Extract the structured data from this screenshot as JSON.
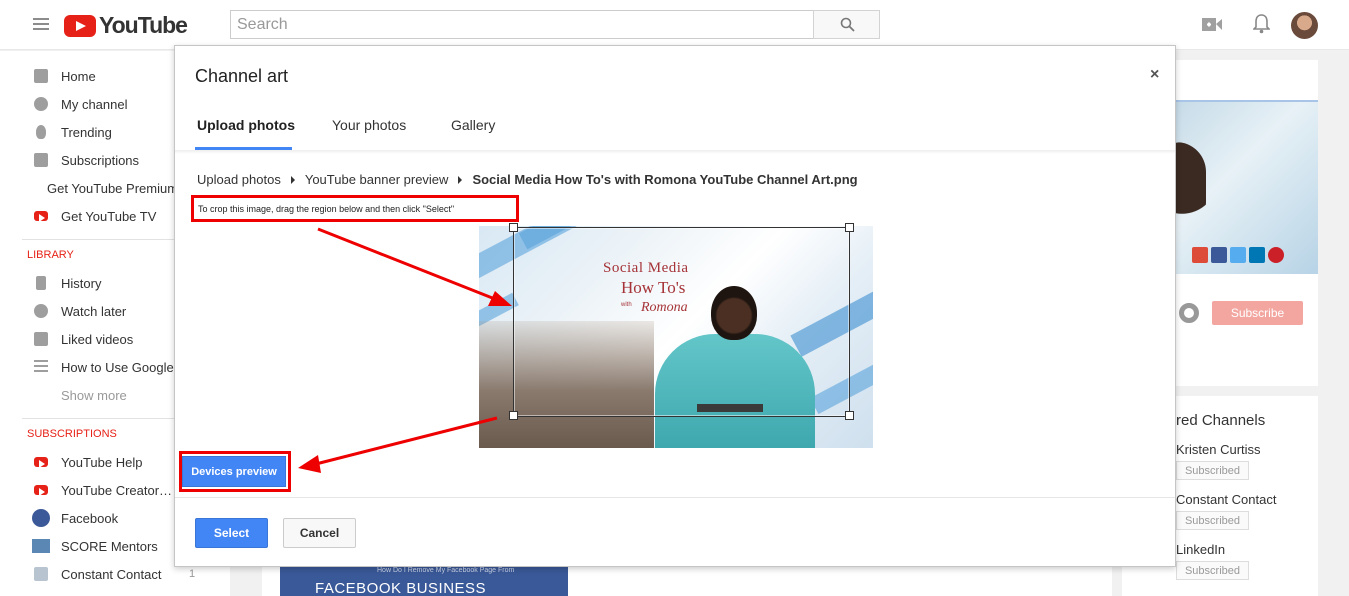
{
  "app": {
    "logo_text": "YouTube",
    "search_placeholder": "Search"
  },
  "sidebar": {
    "main_items": [
      {
        "label": "Home"
      },
      {
        "label": "My channel"
      },
      {
        "label": "Trending"
      },
      {
        "label": "Subscriptions"
      },
      {
        "label": "Get YouTube Premium"
      },
      {
        "label": "Get YouTube TV"
      }
    ],
    "library_heading": "LIBRARY",
    "library_items": [
      {
        "label": "History"
      },
      {
        "label": "Watch later"
      },
      {
        "label": "Liked videos"
      },
      {
        "label": "How to Use Google"
      }
    ],
    "show_more": "Show more",
    "subscriptions_heading": "SUBSCRIPTIONS",
    "subscription_items": [
      {
        "label": "YouTube Help"
      },
      {
        "label": "YouTube Creator…"
      },
      {
        "label": "Facebook"
      },
      {
        "label": "SCORE Mentors"
      },
      {
        "label": "Constant Contact",
        "count": "1"
      }
    ]
  },
  "right_panel": {
    "subscribe_label": "Subscribe",
    "featured_title": "red Channels",
    "featured": [
      {
        "name": "Kristen Curtiss",
        "status": "Subscribed"
      },
      {
        "name": "Constant Contact",
        "status": "Subscribed"
      },
      {
        "name": "LinkedIn",
        "status": "Subscribed"
      }
    ]
  },
  "background_card": {
    "small_text": "How Do I Remove My Facebook Page From",
    "big_text": "FACEBOOK BUSINESS MANAGER"
  },
  "modal": {
    "title": "Channel art",
    "close": "×",
    "tabs": [
      {
        "label": "Upload photos",
        "active": true
      },
      {
        "label": "Your photos",
        "active": false
      },
      {
        "label": "Gallery",
        "active": false
      }
    ],
    "breadcrumb": [
      "Upload photos",
      "YouTube banner preview",
      "Social Media How To's with Romona YouTube Channel Art.png"
    ],
    "instruction": "To crop this image, drag the region below and then click \"Select\"",
    "banner": {
      "line1": "Social Media",
      "line2": "How To's",
      "line3": "with",
      "line4": "Romona"
    },
    "devices_preview": "Devices preview",
    "select": "Select",
    "cancel": "Cancel"
  },
  "colors": {
    "accent_blue": "#4285f4",
    "annotation_red": "#e00000",
    "youtube_red": "#e62117"
  }
}
